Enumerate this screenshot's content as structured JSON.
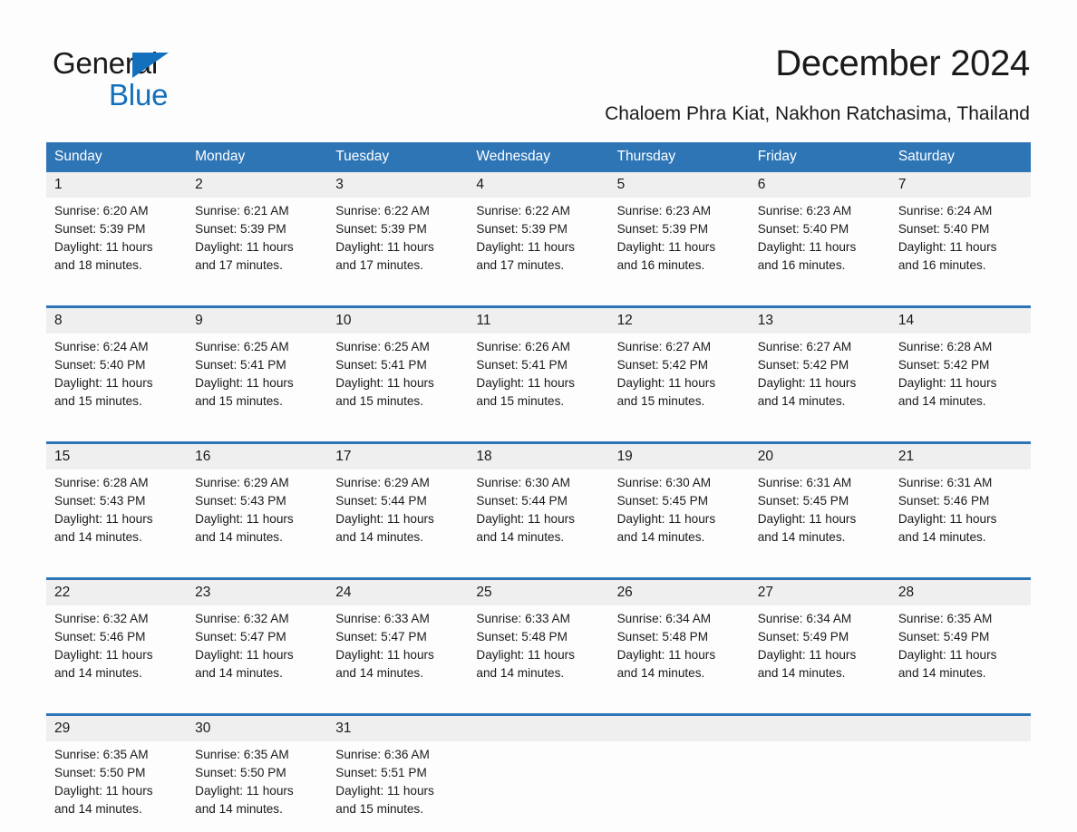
{
  "brand": {
    "line1": "General",
    "line2": "Blue",
    "triangle_color": "#1270bd",
    "text_color": "#1a1a1a"
  },
  "header": {
    "title": "December 2024",
    "subtitle": "Chaloem Phra Kiat, Nakhon Ratchasima, Thailand",
    "accent_color": "#2e75b6",
    "daynum_bg": "#efefef"
  },
  "calendar": {
    "weekday_headers": [
      "Sunday",
      "Monday",
      "Tuesday",
      "Wednesday",
      "Thursday",
      "Friday",
      "Saturday"
    ],
    "weeks": [
      [
        {
          "day": "1",
          "sunrise": "Sunrise: 6:20 AM",
          "sunset": "Sunset: 5:39 PM",
          "daylight_1": "Daylight: 11 hours",
          "daylight_2": "and 18 minutes."
        },
        {
          "day": "2",
          "sunrise": "Sunrise: 6:21 AM",
          "sunset": "Sunset: 5:39 PM",
          "daylight_1": "Daylight: 11 hours",
          "daylight_2": "and 17 minutes."
        },
        {
          "day": "3",
          "sunrise": "Sunrise: 6:22 AM",
          "sunset": "Sunset: 5:39 PM",
          "daylight_1": "Daylight: 11 hours",
          "daylight_2": "and 17 minutes."
        },
        {
          "day": "4",
          "sunrise": "Sunrise: 6:22 AM",
          "sunset": "Sunset: 5:39 PM",
          "daylight_1": "Daylight: 11 hours",
          "daylight_2": "and 17 minutes."
        },
        {
          "day": "5",
          "sunrise": "Sunrise: 6:23 AM",
          "sunset": "Sunset: 5:39 PM",
          "daylight_1": "Daylight: 11 hours",
          "daylight_2": "and 16 minutes."
        },
        {
          "day": "6",
          "sunrise": "Sunrise: 6:23 AM",
          "sunset": "Sunset: 5:40 PM",
          "daylight_1": "Daylight: 11 hours",
          "daylight_2": "and 16 minutes."
        },
        {
          "day": "7",
          "sunrise": "Sunrise: 6:24 AM",
          "sunset": "Sunset: 5:40 PM",
          "daylight_1": "Daylight: 11 hours",
          "daylight_2": "and 16 minutes."
        }
      ],
      [
        {
          "day": "8",
          "sunrise": "Sunrise: 6:24 AM",
          "sunset": "Sunset: 5:40 PM",
          "daylight_1": "Daylight: 11 hours",
          "daylight_2": "and 15 minutes."
        },
        {
          "day": "9",
          "sunrise": "Sunrise: 6:25 AM",
          "sunset": "Sunset: 5:41 PM",
          "daylight_1": "Daylight: 11 hours",
          "daylight_2": "and 15 minutes."
        },
        {
          "day": "10",
          "sunrise": "Sunrise: 6:25 AM",
          "sunset": "Sunset: 5:41 PM",
          "daylight_1": "Daylight: 11 hours",
          "daylight_2": "and 15 minutes."
        },
        {
          "day": "11",
          "sunrise": "Sunrise: 6:26 AM",
          "sunset": "Sunset: 5:41 PM",
          "daylight_1": "Daylight: 11 hours",
          "daylight_2": "and 15 minutes."
        },
        {
          "day": "12",
          "sunrise": "Sunrise: 6:27 AM",
          "sunset": "Sunset: 5:42 PM",
          "daylight_1": "Daylight: 11 hours",
          "daylight_2": "and 15 minutes."
        },
        {
          "day": "13",
          "sunrise": "Sunrise: 6:27 AM",
          "sunset": "Sunset: 5:42 PM",
          "daylight_1": "Daylight: 11 hours",
          "daylight_2": "and 14 minutes."
        },
        {
          "day": "14",
          "sunrise": "Sunrise: 6:28 AM",
          "sunset": "Sunset: 5:42 PM",
          "daylight_1": "Daylight: 11 hours",
          "daylight_2": "and 14 minutes."
        }
      ],
      [
        {
          "day": "15",
          "sunrise": "Sunrise: 6:28 AM",
          "sunset": "Sunset: 5:43 PM",
          "daylight_1": "Daylight: 11 hours",
          "daylight_2": "and 14 minutes."
        },
        {
          "day": "16",
          "sunrise": "Sunrise: 6:29 AM",
          "sunset": "Sunset: 5:43 PM",
          "daylight_1": "Daylight: 11 hours",
          "daylight_2": "and 14 minutes."
        },
        {
          "day": "17",
          "sunrise": "Sunrise: 6:29 AM",
          "sunset": "Sunset: 5:44 PM",
          "daylight_1": "Daylight: 11 hours",
          "daylight_2": "and 14 minutes."
        },
        {
          "day": "18",
          "sunrise": "Sunrise: 6:30 AM",
          "sunset": "Sunset: 5:44 PM",
          "daylight_1": "Daylight: 11 hours",
          "daylight_2": "and 14 minutes."
        },
        {
          "day": "19",
          "sunrise": "Sunrise: 6:30 AM",
          "sunset": "Sunset: 5:45 PM",
          "daylight_1": "Daylight: 11 hours",
          "daylight_2": "and 14 minutes."
        },
        {
          "day": "20",
          "sunrise": "Sunrise: 6:31 AM",
          "sunset": "Sunset: 5:45 PM",
          "daylight_1": "Daylight: 11 hours",
          "daylight_2": "and 14 minutes."
        },
        {
          "day": "21",
          "sunrise": "Sunrise: 6:31 AM",
          "sunset": "Sunset: 5:46 PM",
          "daylight_1": "Daylight: 11 hours",
          "daylight_2": "and 14 minutes."
        }
      ],
      [
        {
          "day": "22",
          "sunrise": "Sunrise: 6:32 AM",
          "sunset": "Sunset: 5:46 PM",
          "daylight_1": "Daylight: 11 hours",
          "daylight_2": "and 14 minutes."
        },
        {
          "day": "23",
          "sunrise": "Sunrise: 6:32 AM",
          "sunset": "Sunset: 5:47 PM",
          "daylight_1": "Daylight: 11 hours",
          "daylight_2": "and 14 minutes."
        },
        {
          "day": "24",
          "sunrise": "Sunrise: 6:33 AM",
          "sunset": "Sunset: 5:47 PM",
          "daylight_1": "Daylight: 11 hours",
          "daylight_2": "and 14 minutes."
        },
        {
          "day": "25",
          "sunrise": "Sunrise: 6:33 AM",
          "sunset": "Sunset: 5:48 PM",
          "daylight_1": "Daylight: 11 hours",
          "daylight_2": "and 14 minutes."
        },
        {
          "day": "26",
          "sunrise": "Sunrise: 6:34 AM",
          "sunset": "Sunset: 5:48 PM",
          "daylight_1": "Daylight: 11 hours",
          "daylight_2": "and 14 minutes."
        },
        {
          "day": "27",
          "sunrise": "Sunrise: 6:34 AM",
          "sunset": "Sunset: 5:49 PM",
          "daylight_1": "Daylight: 11 hours",
          "daylight_2": "and 14 minutes."
        },
        {
          "day": "28",
          "sunrise": "Sunrise: 6:35 AM",
          "sunset": "Sunset: 5:49 PM",
          "daylight_1": "Daylight: 11 hours",
          "daylight_2": "and 14 minutes."
        }
      ],
      [
        {
          "day": "29",
          "sunrise": "Sunrise: 6:35 AM",
          "sunset": "Sunset: 5:50 PM",
          "daylight_1": "Daylight: 11 hours",
          "daylight_2": "and 14 minutes."
        },
        {
          "day": "30",
          "sunrise": "Sunrise: 6:35 AM",
          "sunset": "Sunset: 5:50 PM",
          "daylight_1": "Daylight: 11 hours",
          "daylight_2": "and 14 minutes."
        },
        {
          "day": "31",
          "sunrise": "Sunrise: 6:36 AM",
          "sunset": "Sunset: 5:51 PM",
          "daylight_1": "Daylight: 11 hours",
          "daylight_2": "and 15 minutes."
        },
        {
          "day": "",
          "sunrise": "",
          "sunset": "",
          "daylight_1": "",
          "daylight_2": ""
        },
        {
          "day": "",
          "sunrise": "",
          "sunset": "",
          "daylight_1": "",
          "daylight_2": ""
        },
        {
          "day": "",
          "sunrise": "",
          "sunset": "",
          "daylight_1": "",
          "daylight_2": ""
        },
        {
          "day": "",
          "sunrise": "",
          "sunset": "",
          "daylight_1": "",
          "daylight_2": ""
        }
      ]
    ]
  }
}
